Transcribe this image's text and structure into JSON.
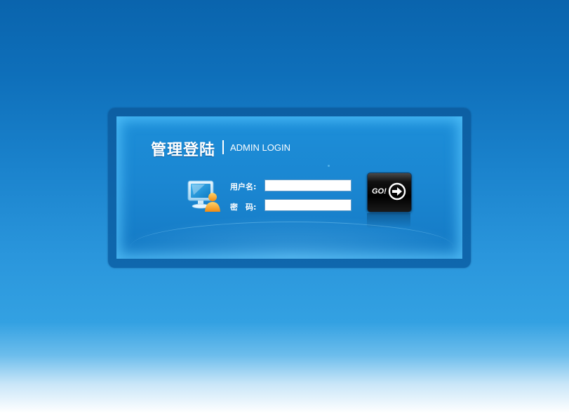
{
  "login": {
    "title_cn": "管理登陆",
    "title_en": "ADMIN LOGIN",
    "username_label": "用户名:",
    "password_label": "密　码:",
    "username_value": "",
    "password_value": "",
    "submit_label": "GO!"
  },
  "icons": {
    "user": "computer-user-icon",
    "submit_arrow": "arrow-right-icon"
  },
  "colors": {
    "background_top": "#0a64ad",
    "background_bottom": "#ffffff",
    "panel": "#1b87d2",
    "text": "#ffffff",
    "button": "#000000"
  }
}
